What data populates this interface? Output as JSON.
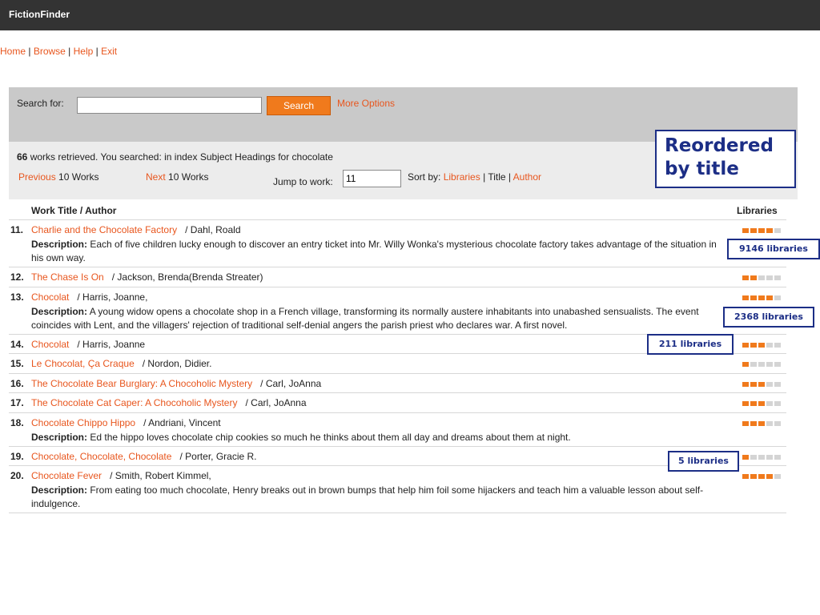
{
  "app": {
    "title": "FictionFinder"
  },
  "topnav": {
    "home": "Home",
    "browse": "Browse",
    "help": "Help",
    "exit": "Exit"
  },
  "search": {
    "label": "Search for:",
    "value": "",
    "button": "Search",
    "more_options": "More Options"
  },
  "results": {
    "count": "66",
    "summary_text": " works retrieved. You searched: in index Subject Headings for chocolate",
    "prev_link": "Previous",
    "prev_text": " 10 Works",
    "next_link": "Next",
    "next_text": " 10 Works",
    "jump_label": "Jump to work:",
    "jump_value": "11",
    "sort_label": "Sort by:",
    "sort_libraries": "Libraries",
    "sort_title": "Title",
    "sort_author": "Author"
  },
  "table": {
    "col_title": "Work Title / Author",
    "col_libraries": "Libraries"
  },
  "rows": [
    {
      "num": "11.",
      "title": "Charlie and the Chocolate Factory",
      "author": "/ Dahl, Roald",
      "desc_label": "Description:",
      "desc": " Each of five children lucky enough to discover an entry ticket into Mr. Willy Wonka's mysterious chocolate factory takes advantage of the situation in his own way.",
      "bars": 4
    },
    {
      "num": "12.",
      "title": "The Chase Is On",
      "author": "/ Jackson, Brenda(Brenda Streater)",
      "bars": 2
    },
    {
      "num": "13.",
      "title": "Chocolat",
      "author": "/ Harris, Joanne,",
      "desc_label": "Description:",
      "desc": " A young widow opens a chocolate shop in a French village, transforming its normally austere inhabitants into unabashed sensualists. The event coincides with Lent, and the villagers' rejection of traditional self-denial angers the parish priest who declares war. A first novel.",
      "bars": 4
    },
    {
      "num": "14.",
      "title": "Chocolat",
      "author": "/ Harris, Joanne",
      "bars": 3
    },
    {
      "num": "15.",
      "title": "Le Chocolat, Ça Craque",
      "author": "/ Nordon, Didier.",
      "bars": 1
    },
    {
      "num": "16.",
      "title": "The Chocolate Bear Burglary: A Chocoholic Mystery",
      "author": "/ Carl, JoAnna",
      "bars": 3
    },
    {
      "num": "17.",
      "title": "The Chocolate Cat Caper: A Chocoholic Mystery",
      "author": "/ Carl, JoAnna",
      "bars": 3
    },
    {
      "num": "18.",
      "title": "Chocolate Chippo Hippo",
      "author": "/ Andriani, Vincent",
      "desc_label": "Description:",
      "desc": " Ed the hippo loves chocolate chip cookies so much he thinks about them all day and dreams about them at night.",
      "bars": 3
    },
    {
      "num": "19.",
      "title": "Chocolate, Chocolate, Chocolate",
      "author": "/ Porter, Gracie R.",
      "bars": 1
    },
    {
      "num": "20.",
      "title": "Chocolate Fever",
      "author": "/ Smith, Robert Kimmel,",
      "desc_label": "Description:",
      "desc": " From eating too much chocolate, Henry breaks out in brown bumps that help him foil some hijackers and teach him a valuable lesson about self-indulgence.",
      "bars": 4
    }
  ],
  "callouts": {
    "reordered": "Reordered by title",
    "c9146": "9146 libraries",
    "c2368": "2368 libraries",
    "c211": "211 libraries",
    "c5": "5 libraries"
  },
  "colors": {
    "accent": "#e8561e",
    "bar_on": "#f07a1c",
    "bar_off": "#d4d4d4",
    "topbar": "#333333",
    "callout": "#1c2e86"
  }
}
